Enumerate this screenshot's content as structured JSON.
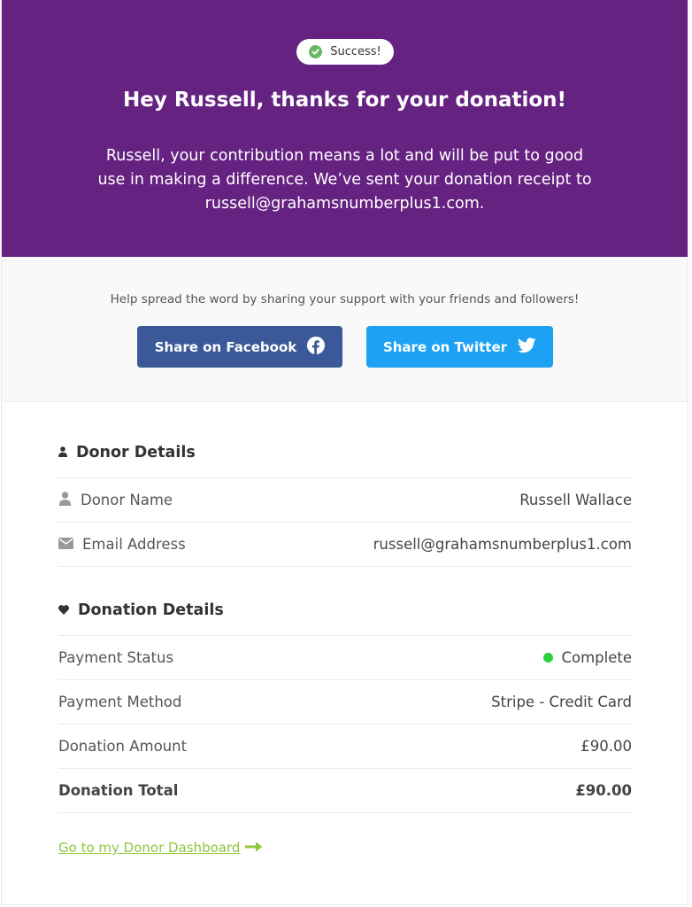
{
  "hero": {
    "badge_text": "Success!",
    "title": "Hey Russell, thanks for your donation!",
    "message": "Russell, your contribution means a lot and will be put to good use in making a difference. We’ve sent your donation receipt to russell@grahamsnumberplus1.com."
  },
  "share": {
    "hint": "Help spread the word by sharing your support with your friends and followers!",
    "facebook_label": "Share on Facebook",
    "twitter_label": "Share on Twitter"
  },
  "donor_details": {
    "title": "Donor Details",
    "rows": [
      {
        "label": "Donor Name",
        "value": "Russell Wallace",
        "icon": "user-icon"
      },
      {
        "label": "Email Address",
        "value": "russell@grahamsnumberplus1.com",
        "icon": "envelope-icon"
      }
    ]
  },
  "donation_details": {
    "title": "Donation Details",
    "rows": [
      {
        "label": "Payment Status",
        "value": "Complete"
      },
      {
        "label": "Payment Method",
        "value": "Stripe - Credit Card"
      },
      {
        "label": "Donation Amount",
        "value": "£90.00"
      },
      {
        "label": "Donation Total",
        "value": "£90.00"
      }
    ]
  },
  "dashboard_link": "Go to my Donor Dashboard",
  "colors": {
    "hero_bg": "#662281",
    "facebook": "#3b5998",
    "twitter": "#1da1f2",
    "success": "#69b868",
    "status_complete": "#2bd03a",
    "link": "#8dc63f"
  }
}
